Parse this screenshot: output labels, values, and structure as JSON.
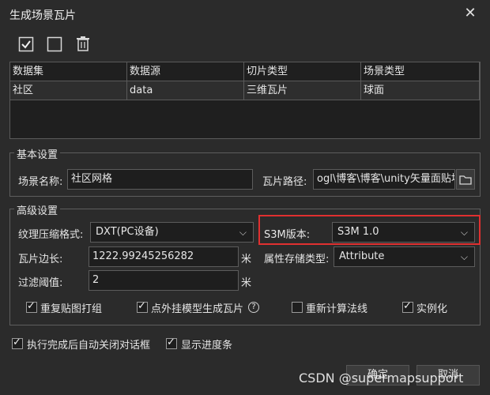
{
  "window": {
    "title": "生成场景瓦片"
  },
  "toolbar": {
    "select_all_icon": "check-square-icon",
    "invert_icon": "square-icon",
    "delete_icon": "trash-icon"
  },
  "grid": {
    "headers": [
      "数据集",
      "数据源",
      "切片类型",
      "场景类型"
    ],
    "rows": [
      [
        "社区",
        "data",
        "三维瓦片",
        "球面"
      ]
    ]
  },
  "basic": {
    "legend": "基本设置",
    "scene_name_label": "场景名称:",
    "scene_name_value": "社区网格",
    "tile_path_label": "瓦片路径:",
    "tile_path_value": "ogl\\博客\\博客\\unity矢量面贴地"
  },
  "advanced": {
    "legend": "高级设置",
    "texture_label": "纹理压缩格式:",
    "texture_value": "DXT(PC设备)",
    "s3m_label": "S3M版本:",
    "s3m_value": "S3M 1.0",
    "tile_side_label": "瓦片边长:",
    "tile_side_value": "1222.99245256282",
    "tile_side_unit": "米",
    "attr_label": "属性存储类型:",
    "attr_value": "Attribute",
    "filter_label": "过滤阈值:",
    "filter_value": "2",
    "filter_unit": "米",
    "opt_repeat": "重复贴图打组",
    "opt_point": "点外挂模型生成瓦片",
    "opt_normals": "重新计算法线",
    "opt_instance": "实例化"
  },
  "footer": {
    "auto_close": "执行完成后自动关闭对话框",
    "show_progress": "显示进度条",
    "ok": "确定",
    "cancel": "取消"
  },
  "watermark": "CSDN @supermapsupport"
}
